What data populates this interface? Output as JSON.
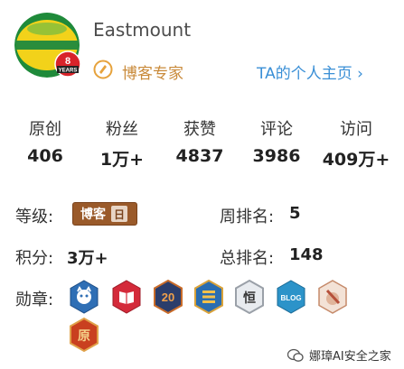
{
  "profile": {
    "username": "Eastmount",
    "years_number": "8",
    "years_text": "YEARS",
    "expert_label": "博客专家",
    "home_link": "TA的个人主页 ›"
  },
  "stats": [
    {
      "label": "原创",
      "value": "406"
    },
    {
      "label": "粉丝",
      "value": "1万+"
    },
    {
      "label": "获赞",
      "value": "4837"
    },
    {
      "label": "评论",
      "value": "3986"
    },
    {
      "label": "访问",
      "value": "409万+"
    }
  ],
  "level": {
    "label": "等级:",
    "badge_text": "博客",
    "badge_num": "日"
  },
  "points": {
    "label": "积分:",
    "value": "3万+"
  },
  "weekly_rank": {
    "label": "周排名:",
    "value": "5"
  },
  "total_rank": {
    "label": "总排名:",
    "value": "148"
  },
  "medals": {
    "label": "勋章:",
    "items": [
      {
        "name": "github-medal-icon",
        "color": "#2f6fb5"
      },
      {
        "name": "book-medal-icon",
        "color": "#d42a3a"
      },
      {
        "name": "twenty-medal-icon",
        "color": "#2b3d6b",
        "text": "20"
      },
      {
        "name": "list-medal-icon",
        "color": "#2a6db0"
      },
      {
        "name": "heng-medal-icon",
        "color": "#c8ccd2",
        "text": "恒"
      },
      {
        "name": "blog-medal-icon",
        "color": "#2c93c9",
        "text": "BLOG"
      },
      {
        "name": "pen-medal-icon",
        "color": "#e8cfc0"
      },
      {
        "name": "yuan-medal-icon",
        "color": "#c9401f",
        "text": "原"
      }
    ]
  },
  "watermark": {
    "text": "娜璋AI安全之家"
  }
}
